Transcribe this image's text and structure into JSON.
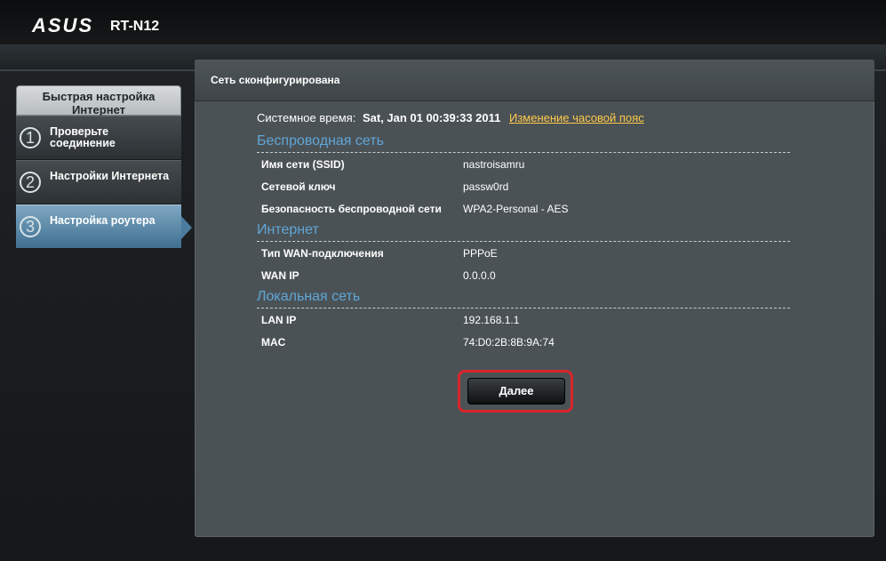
{
  "header": {
    "brand": "ASUS",
    "model": "RT-N12"
  },
  "sidebar": {
    "title": "Быстрая настройка Интернет",
    "steps": [
      {
        "num": "1",
        "label": "Проверьте соединение"
      },
      {
        "num": "2",
        "label": "Настройки Интернета"
      },
      {
        "num": "3",
        "label": "Настройка роутера"
      }
    ],
    "active_step": 3
  },
  "panel": {
    "title": "Сеть сконфигурирована",
    "system_time": {
      "label": "Системное время:",
      "value": "Sat, Jan 01 00:39:33 2011",
      "link": "Изменение часовой пояс"
    },
    "wireless": {
      "heading": "Беспроводная сеть",
      "rows": [
        {
          "key": "Имя сети (SSID)",
          "value": "nastroisamru"
        },
        {
          "key": "Сетевой ключ",
          "value": "passw0rd"
        },
        {
          "key": "Безопасность беспроводной сети",
          "value": "WPA2-Personal - AES"
        }
      ]
    },
    "internet": {
      "heading": "Интернет",
      "rows": [
        {
          "key": "Тип WAN-подключения",
          "value": "PPPoE"
        },
        {
          "key": "WAN IP",
          "value": "0.0.0.0"
        }
      ]
    },
    "lan": {
      "heading": "Локальная сеть",
      "rows": [
        {
          "key": "LAN IP",
          "value": "192.168.1.1"
        },
        {
          "key": "MAC",
          "value": "74:D0:2B:8B:9A:74"
        }
      ]
    },
    "next_button": "Далее"
  },
  "colors": {
    "accent_section": "#5fa6d6",
    "link": "#ffc94a",
    "highlight_border": "#d9252c",
    "active_step": "#4c7c9d"
  }
}
